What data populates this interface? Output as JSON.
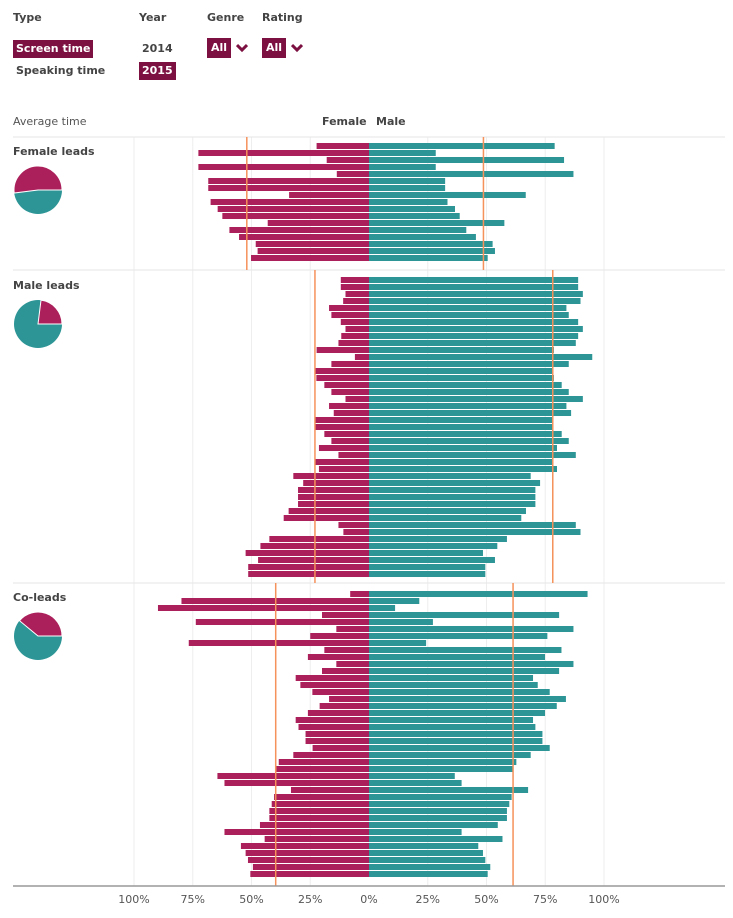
{
  "controls": {
    "type_label": "Type",
    "year_label": "Year",
    "genre_label": "Genre",
    "rating_label": "Rating",
    "type_options": [
      {
        "label": "Screen time",
        "active": true
      },
      {
        "label": "Speaking time",
        "active": false
      }
    ],
    "year_options": [
      {
        "label": "2014",
        "active": false
      },
      {
        "label": "2015",
        "active": true
      }
    ],
    "genre_value": "All",
    "rating_value": "All"
  },
  "colors": {
    "accent": "#7c1141",
    "female": "#ab1f5a",
    "male": "#2d9596",
    "average_line": "#f5915a",
    "grid": "#eeeeee"
  },
  "chart_data": {
    "type": "bar",
    "orientation": "horizontal-diverging",
    "title": "Average time",
    "left_label": "Female",
    "right_label": "Male",
    "x_ticks": [
      "100%",
      "75%",
      "50%",
      "25%",
      "0%",
      "25%",
      "50%",
      "75%",
      "100%"
    ],
    "xlim": [
      -100,
      100
    ],
    "groups": [
      {
        "name": "Female leads",
        "avg_female": 52,
        "avg_male": 48.7,
        "pie_female_share": 52,
        "female": [
          22.3,
          72.6,
          18,
          72.6,
          13.7,
          68.4,
          68.4,
          34,
          67.4,
          64.4,
          62.4,
          43.1,
          59.4,
          55.3,
          48.2,
          47.4,
          50.2
        ],
        "male": [
          79,
          28.4,
          83,
          28.4,
          87,
          32.4,
          32.4,
          66.7,
          33.4,
          36.6,
          38.6,
          57.6,
          41.4,
          45.5,
          52.6,
          53.6,
          50.5
        ]
      },
      {
        "name": "Male leads",
        "avg_female": 23,
        "avg_male": 78.2,
        "pie_female_share": 23,
        "female": [
          12,
          12,
          10,
          11,
          17,
          16,
          12,
          10,
          11.8,
          13,
          22.3,
          6,
          16,
          22.8,
          22.4,
          19,
          16,
          10,
          17,
          15,
          22.8,
          22.8,
          19,
          16,
          21.3,
          13,
          23,
          21.3,
          32.2,
          28,
          30.2,
          30.2,
          30.2,
          34.2,
          36.3,
          13,
          10.9,
          42.4,
          46.2,
          52.5,
          47.2,
          51.4,
          51.4
        ],
        "male": [
          89,
          89,
          91,
          90,
          84,
          85,
          89,
          91,
          89,
          88,
          78.7,
          95,
          85,
          78,
          78.7,
          82,
          85,
          91,
          84,
          86,
          78,
          78,
          82,
          85,
          80,
          88,
          78,
          80,
          68.8,
          72.8,
          70.8,
          70.8,
          70.8,
          66.8,
          64.8,
          88,
          90,
          58.7,
          54.6,
          48.5,
          53.6,
          49.5,
          49.5
        ]
      },
      {
        "name": "Co-leads",
        "avg_female": 39.7,
        "avg_male": 61.3,
        "pie_female_share": 39,
        "female": [
          8,
          79.8,
          89.8,
          20,
          73.7,
          13.9,
          25,
          76.7,
          19,
          26,
          13.9,
          20,
          31.2,
          29.2,
          24.1,
          17,
          21,
          26,
          31.2,
          30,
          27,
          27,
          24,
          32.2,
          38.4,
          39.4,
          64.5,
          61.5,
          33.2,
          40.4,
          41.4,
          42.4,
          42.4,
          46.4,
          61.5,
          44.4,
          54.5,
          52.5,
          51.5,
          49.4,
          50.5
        ],
        "male": [
          93,
          21.4,
          11.1,
          80.9,
          27.2,
          87,
          75.9,
          24.3,
          81.9,
          74.9,
          87,
          80.9,
          69.8,
          71.8,
          76.9,
          83.8,
          79.9,
          74.9,
          69.8,
          70.8,
          73.8,
          73.8,
          76.9,
          68.8,
          62.7,
          61.2,
          36.5,
          39.4,
          67.7,
          60.7,
          59.7,
          58.7,
          58.7,
          54.8,
          39.4,
          56.8,
          46.5,
          48.5,
          49.5,
          51.6,
          50.5
        ]
      }
    ]
  }
}
